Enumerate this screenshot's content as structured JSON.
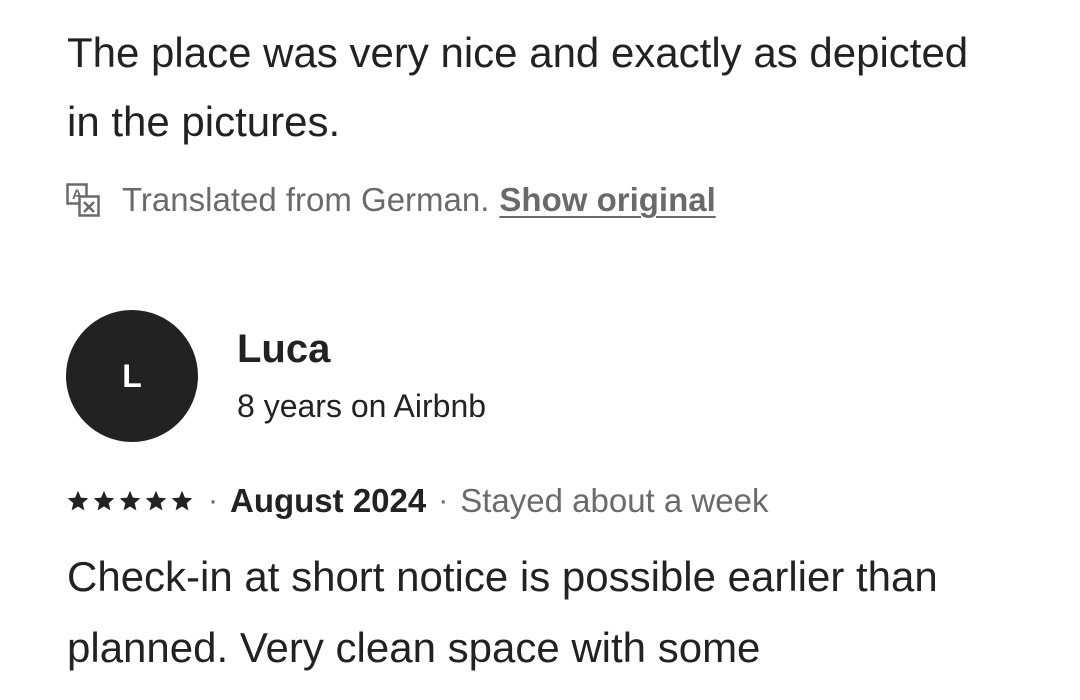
{
  "previous_review": {
    "text": "The place was very nice and exactly as depicted in the pictures.",
    "translation_note": "Translated from German.",
    "show_original_label": "Show original"
  },
  "review": {
    "avatar_initial": "L",
    "reviewer_name": "Luca",
    "reviewer_tenure": "8 years on Airbnb",
    "rating": 5,
    "date": "August 2024",
    "stay_length": "Stayed about a week",
    "text": "Check-in at short notice is possible earlier than planned. Very clean space with some"
  },
  "icons": {
    "translate": "translate-icon",
    "star": "star-icon"
  },
  "colors": {
    "text_primary": "#222222",
    "text_secondary": "#6a6a6a",
    "avatar_bg": "#222222",
    "background": "#ffffff"
  }
}
